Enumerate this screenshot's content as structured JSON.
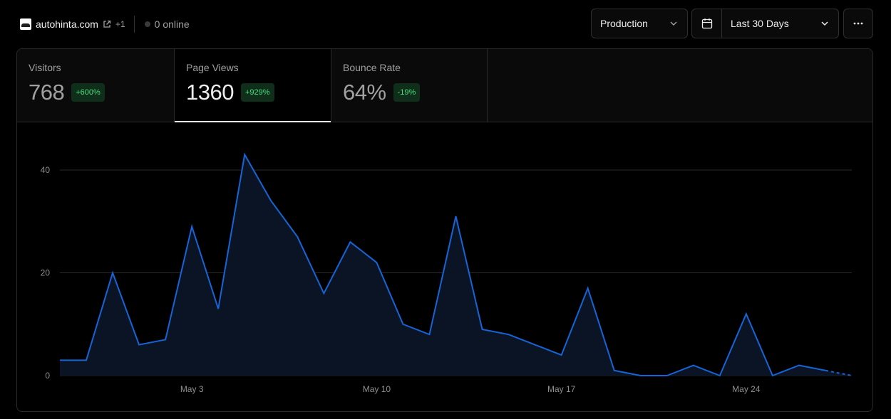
{
  "header": {
    "site_name": "autohinta.com",
    "extra_count": "+1",
    "online_text": "0 online",
    "environment": "Production",
    "date_range": "Last 30 Days"
  },
  "metrics": [
    {
      "label": "Visitors",
      "value": "768",
      "change": "+600%"
    },
    {
      "label": "Page Views",
      "value": "1360",
      "change": "+929%"
    },
    {
      "label": "Bounce Rate",
      "value": "64%",
      "change": "-19%"
    }
  ],
  "selected_metric": "Page Views",
  "colors": {
    "line": "#1565d8",
    "area": "#0a1424",
    "badge_text": "#4ade80",
    "badge_bg": "#0f2f1b",
    "grid": "#2a2a2a"
  },
  "chart_data": {
    "type": "area",
    "title": "",
    "xlabel": "",
    "ylabel": "",
    "y_ticks": [
      0,
      20,
      40
    ],
    "ylim": [
      0,
      40
    ],
    "x_tick_labels": [
      "May 3",
      "May 10",
      "May 17",
      "May 24"
    ],
    "x_tick_indices": [
      5,
      12,
      19,
      26
    ],
    "grid": "horizontal",
    "last_segment_dashed": true,
    "series": [
      {
        "values": [
          3,
          3,
          20,
          6,
          7,
          29,
          13,
          43,
          34,
          27,
          16,
          26,
          22,
          10,
          8,
          31,
          9,
          8,
          6,
          4,
          17,
          1,
          0,
          0,
          2,
          0,
          12,
          0,
          2,
          1,
          0
        ]
      }
    ]
  }
}
